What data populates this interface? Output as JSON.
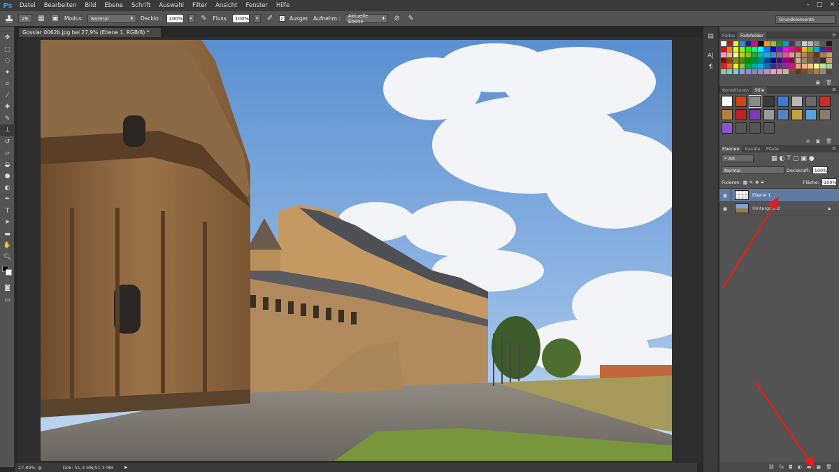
{
  "app": {
    "logo": "Ps"
  },
  "menu": [
    "Datei",
    "Bearbeiten",
    "Bild",
    "Ebene",
    "Schrift",
    "Auswahl",
    "Filter",
    "Ansicht",
    "Fenster",
    "Hilfe"
  ],
  "window_controls": [
    "–",
    "□",
    "✕"
  ],
  "options": {
    "brush_size": "29",
    "mode_label": "Modus:",
    "mode_value": "Normal",
    "opacity_label": "Deckkr.:",
    "opacity_value": "100%",
    "flow_label": "Fluss:",
    "flow_value": "100%",
    "aligned_label": "Ausger.",
    "sample_label": "Aufnehm.:",
    "sample_value": "Aktuelle Ebene"
  },
  "workspace": "Grundelemente",
  "document": {
    "tab_title": "Gosslar 0062b.jpg bei 27,9% (Ebene 1, RGB/8) *",
    "zoom": "27,89%",
    "doc_size": "Dok: 51,3 MB/51,3 MB"
  },
  "swatch_panel": {
    "tabs": [
      "Farbe",
      "Farbfelder"
    ],
    "active_tab": "Farbfelder",
    "colors": [
      "#ffffff",
      "#e60012",
      "#fff100",
      "#00a0e9",
      "#1d2088",
      "#e4007f",
      "#000000",
      "#f39800",
      "#8fc31f",
      "#009944",
      "#00a0c1",
      "#920783",
      "#7d7d7d",
      "#c9caca",
      "#b5b5b6",
      "#898989",
      "#595757",
      "#231815",
      "#ff0000",
      "#ff7f00",
      "#ffff00",
      "#7fff00",
      "#00ff00",
      "#00ff7f",
      "#00ffff",
      "#007fff",
      "#0000ff",
      "#7f00ff",
      "#ff00ff",
      "#ff007f",
      "#e5004f",
      "#f8b500",
      "#6fba2c",
      "#00a7eb",
      "#2e3192",
      "#9e005d",
      "#f19ec2",
      "#f6b37f",
      "#fff799",
      "#c3d600",
      "#8dc21f",
      "#22ac38",
      "#13b5b1",
      "#00b7ee",
      "#448aca",
      "#8c6ab0",
      "#e95388",
      "#d4a28b",
      "#cfa972",
      "#b28850",
      "#8b5e3c",
      "#603813",
      "#a67c52",
      "#c69c6d",
      "#8a0000",
      "#8a4500",
      "#8a8a00",
      "#458a00",
      "#008a00",
      "#008a45",
      "#008a8a",
      "#00458a",
      "#00008a",
      "#45008a",
      "#8a008a",
      "#8a0045",
      "#c7b299",
      "#998675",
      "#736357",
      "#534741",
      "#362f2d",
      "#c69c6d",
      "#ed1c24",
      "#f26522",
      "#fff200",
      "#8dc63f",
      "#00a651",
      "#00a99d",
      "#00aeef",
      "#0072bc",
      "#2e3192",
      "#662d91",
      "#92278f",
      "#ec008c",
      "#f7977a",
      "#fbad82",
      "#fdc68c",
      "#fff79a",
      "#c4df9b",
      "#a3d39c",
      "#82ca9c",
      "#7accc8",
      "#6dcff6",
      "#7da7d8",
      "#8393ca",
      "#8781bd",
      "#a186be",
      "#bd8cbf",
      "#f49ac1",
      "#f6989d",
      "#c2b59b",
      "#a0410d",
      "#603913",
      "#754c24",
      "#8c6239",
      "#a67c52",
      "#998675",
      "#534741"
    ]
  },
  "styles_panel": {
    "tabs": [
      "Korrekturen",
      "Stile"
    ],
    "active_tab": "Stile",
    "items": [
      "none-style-icon",
      "fire-style-icon",
      "blank-style-icon",
      "chrome-style-icon",
      "blue-glass-style-icon",
      "gray-style-icon",
      "dark-frame-style-icon",
      "red-glass-style-icon",
      "bronze-style-icon",
      "red-style-icon",
      "purple-style-icon",
      "gray-gloss-style-icon",
      "blue-border-style-icon",
      "gold-style-icon",
      "blue-sky-style-icon",
      "stone-style-icon",
      "purple-glow-style-icon",
      "empty-slot-1",
      "empty-slot-2",
      "empty-slot-3"
    ],
    "style_colors": [
      "#ffffff",
      "#d0451b",
      "#8a8a8a",
      "#3a3a3a",
      "#3d7ad3",
      "#b8b8b8",
      "#6a6a6a",
      "#cc2a2a",
      "#b57f3a",
      "#c02020",
      "#7a3ab0",
      "#999999",
      "#5a80c0",
      "#c9a040",
      "#5aa0e0",
      "#8a7a6a",
      "#8855cc",
      "#555555",
      "#555555",
      "#555555"
    ]
  },
  "layers_panel": {
    "tabs": [
      "Ebenen",
      "Kanäle",
      "Pfade"
    ],
    "active_tab": "Ebenen",
    "filter_label": "Art",
    "blend_mode": "Normal",
    "opacity_label": "Deckkraft:",
    "opacity_value": "100%",
    "lock_label": "Fixieren:",
    "fill_label": "Fläche:",
    "fill_value": "100%",
    "layers": [
      {
        "name": "Ebene 1",
        "selected": true,
        "thumb": "transparent"
      },
      {
        "name": "Hintergrund",
        "selected": false,
        "thumb": "photo",
        "locked": true
      }
    ]
  }
}
